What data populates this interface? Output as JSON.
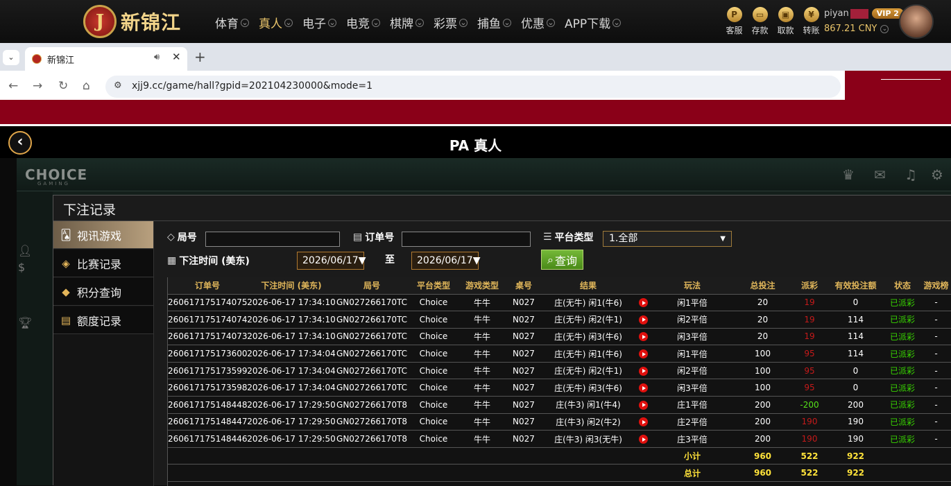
{
  "site": {
    "logo_mark": "J",
    "logo_text": "新锦江",
    "nav": [
      {
        "label": "体育",
        "active": false
      },
      {
        "label": "真人",
        "active": true
      },
      {
        "label": "电子",
        "active": false
      },
      {
        "label": "电竞",
        "active": false
      },
      {
        "label": "棋牌",
        "active": false
      },
      {
        "label": "彩票",
        "active": false
      },
      {
        "label": "捕鱼",
        "active": false
      },
      {
        "label": "优惠",
        "active": false
      },
      {
        "label": "APP下载",
        "active": false
      }
    ],
    "tools": [
      {
        "label": "客服",
        "icon": "customer-service-icon",
        "glyph": "P"
      },
      {
        "label": "存款",
        "icon": "deposit-wallet-icon",
        "glyph": "▭"
      },
      {
        "label": "取款",
        "icon": "withdraw-bag-icon",
        "glyph": "▣"
      },
      {
        "label": "转账",
        "icon": "transfer-coin-icon",
        "glyph": "¥"
      }
    ],
    "username_prefix": "piyan",
    "vip": "VIP 2",
    "balance": "867.21 CNY"
  },
  "browser": {
    "tab_title": "新锦江",
    "url": "xjj9.cc/game/hall?gpid=202104230000&mode=1"
  },
  "game": {
    "title": "PA 真人",
    "provider_logo": "CHOICE",
    "provider_sub": "GAMING"
  },
  "modal": {
    "title": "下注记录",
    "side_menu": [
      {
        "label": "视讯游戏",
        "icon": "cards-icon",
        "glyph": "🂡",
        "active": true
      },
      {
        "label": "比赛记录",
        "icon": "ticket-icon",
        "glyph": "◈",
        "active": false
      },
      {
        "label": "积分查询",
        "icon": "diamond-icon",
        "glyph": "◆",
        "active": false
      },
      {
        "label": "额度记录",
        "icon": "document-icon",
        "glyph": "▤",
        "active": false
      }
    ],
    "filters": {
      "round_label": "局号",
      "order_label": "订单号",
      "platform_label": "平台类型",
      "platform_value": "1.全部",
      "time_label": "下注时间 (美东)",
      "date_from": "2026/06/17",
      "to_label": "至",
      "date_to": "2026/06/17",
      "query_label": "查询"
    },
    "table": {
      "headers": [
        "订单号",
        "下注时间 (美东)",
        "局号",
        "平台类型",
        "游戏类型",
        "桌号",
        "结果",
        "",
        "玩法",
        "总投注",
        "派彩",
        "有效投注额",
        "状态",
        "游戏榜"
      ],
      "rows": [
        [
          "260617175174075",
          "2026-06-17 17:34:10",
          "GN027266170TC",
          "Choice",
          "牛牛",
          "N027",
          "庄(无牛) 闲1(牛6)",
          "闲1平倍",
          "20",
          "19",
          "0",
          "已派彩",
          "-"
        ],
        [
          "260617175174074",
          "2026-06-17 17:34:10",
          "GN027266170TC",
          "Choice",
          "牛牛",
          "N027",
          "庄(无牛) 闲2(牛1)",
          "闲2平倍",
          "20",
          "19",
          "114",
          "已派彩",
          "-"
        ],
        [
          "260617175174073",
          "2026-06-17 17:34:10",
          "GN027266170TC",
          "Choice",
          "牛牛",
          "N027",
          "庄(无牛) 闲3(牛6)",
          "闲3平倍",
          "20",
          "19",
          "114",
          "已派彩",
          "-"
        ],
        [
          "260617175173600",
          "2026-06-17 17:34:04",
          "GN027266170TC",
          "Choice",
          "牛牛",
          "N027",
          "庄(无牛) 闲1(牛6)",
          "闲1平倍",
          "100",
          "95",
          "114",
          "已派彩",
          "-"
        ],
        [
          "260617175173599",
          "2026-06-17 17:34:04",
          "GN027266170TC",
          "Choice",
          "牛牛",
          "N027",
          "庄(无牛) 闲2(牛1)",
          "闲2平倍",
          "100",
          "95",
          "0",
          "已派彩",
          "-"
        ],
        [
          "260617175173598",
          "2026-06-17 17:34:04",
          "GN027266170TC",
          "Choice",
          "牛牛",
          "N027",
          "庄(无牛) 闲3(牛6)",
          "闲3平倍",
          "100",
          "95",
          "0",
          "已派彩",
          "-"
        ],
        [
          "260617175148448",
          "2026-06-17 17:29:50",
          "GN027266170T8",
          "Choice",
          "牛牛",
          "N027",
          "庄(牛3) 闲1(牛4)",
          "庄1平倍",
          "200",
          "-200",
          "200",
          "已派彩",
          "-"
        ],
        [
          "260617175148447",
          "2026-06-17 17:29:50",
          "GN027266170T8",
          "Choice",
          "牛牛",
          "N027",
          "庄(牛3) 闲2(牛2)",
          "庄2平倍",
          "200",
          "190",
          "190",
          "已派彩",
          "-"
        ],
        [
          "260617175148446",
          "2026-06-17 17:29:50",
          "GN027266170T8",
          "Choice",
          "牛牛",
          "N027",
          "庄(牛3) 闲3(无牛)",
          "庄3平倍",
          "200",
          "190",
          "190",
          "已派彩",
          "-"
        ]
      ],
      "subtotal": {
        "label": "小计",
        "total_bet": "960",
        "payout": "522",
        "valid_bet": "922"
      },
      "total": {
        "label": "总计",
        "total_bet": "960",
        "payout": "522",
        "valid_bet": "922"
      }
    }
  },
  "colors": {
    "gold": "#e0b65a",
    "payout_red": "#c41a1a",
    "status_green": "#38d400",
    "sum_yellow": "#ffe23a",
    "redaction": "#8a0018"
  }
}
